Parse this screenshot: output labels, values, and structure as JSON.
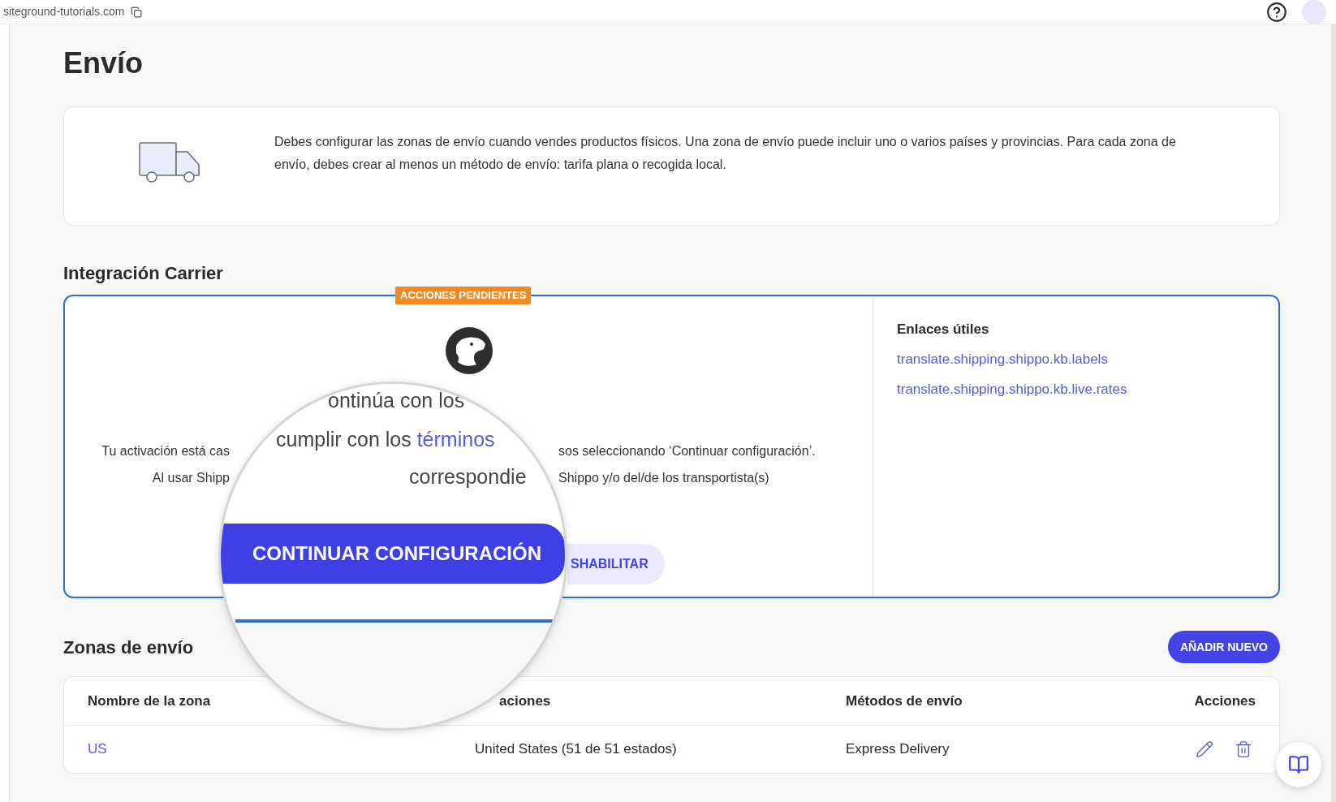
{
  "browser": {
    "address": "siteground-tutorials.com"
  },
  "page_title": "Envío",
  "info": {
    "text": "Debes configurar las zonas de envío cuando vendes productos físicos. Una zona de envío puede incluir uno o varios países y provincias. Para cada zona de envío, debes crear al menos un método de envío: tarifa plana o recogida local."
  },
  "carrier": {
    "title": "Integración Carrier",
    "badge": "ACCIONES PENDIENTES",
    "lines": [
      {
        "left": "Tu activación está cas",
        "right": "sos seleccionando ‘Continuar configuración’."
      },
      {
        "left": "Al usar Shipp",
        "right": "Shippo y/o del/de los transportista(s)"
      }
    ],
    "secondary_button": "SHABILITAR",
    "links_title": "Enlaces útiles",
    "links": [
      "translate.shipping.shippo.kb.labels",
      "translate.shipping.shippo.kb.live.rates"
    ]
  },
  "magnifier": {
    "line_1": "ontinúa con los",
    "line_2": "cumplir con los ",
    "line_2_link": "términos",
    "line_3": "correspondie",
    "button": "CONTINUAR CONFIGURACIÓN"
  },
  "zones": {
    "title": "Zonas de envío",
    "add_button": "AÑADIR NUEVO",
    "columns": [
      "Nombre de la zona",
      "aciones",
      "Métodos de envío",
      "Acciones"
    ],
    "rows": [
      {
        "name": "US",
        "locations": "United States (51 de 51 estados)",
        "methods": "Express Delivery"
      }
    ]
  }
}
